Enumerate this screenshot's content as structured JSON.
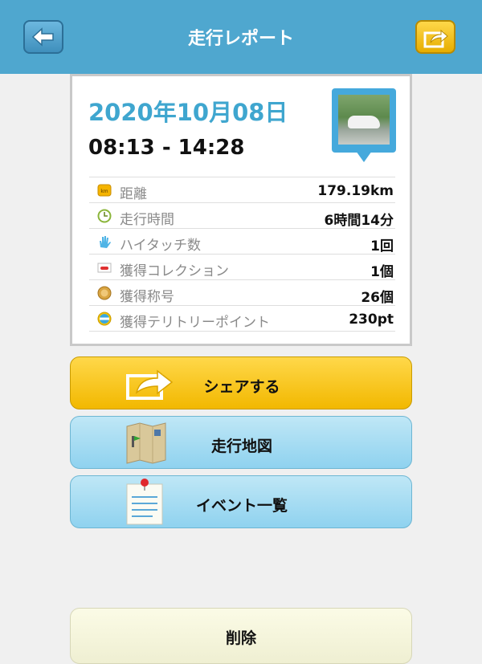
{
  "header": {
    "title": "走行レポート",
    "back_icon": "arrow-left-icon",
    "share_icon": "share-icon"
  },
  "report": {
    "date": "2020年10月08日",
    "time_range": "08:13 - 14:28",
    "stats": [
      {
        "icon": "km-icon",
        "label": "距離",
        "value": "179.19km"
      },
      {
        "icon": "clock-icon",
        "label": "走行時間",
        "value": "6時間14分"
      },
      {
        "icon": "hand-icon",
        "label": "ハイタッチ数",
        "value": "1回"
      },
      {
        "icon": "car-card-icon",
        "label": "獲得コレクション",
        "value": "1個"
      },
      {
        "icon": "medal-icon",
        "label": "獲得称号",
        "value": "26個"
      },
      {
        "icon": "spot-icon",
        "label": "獲得テリトリーポイント",
        "value": "230pt"
      }
    ]
  },
  "buttons": {
    "share": "シェアする",
    "map": "走行地図",
    "events": "イベント一覧",
    "delete": "削除"
  },
  "colors": {
    "header": "#4fa7cf",
    "accent_blue": "#3fa6cf",
    "share_yellow": "#f2b800",
    "light_blue_button": "#9fd8f1"
  }
}
